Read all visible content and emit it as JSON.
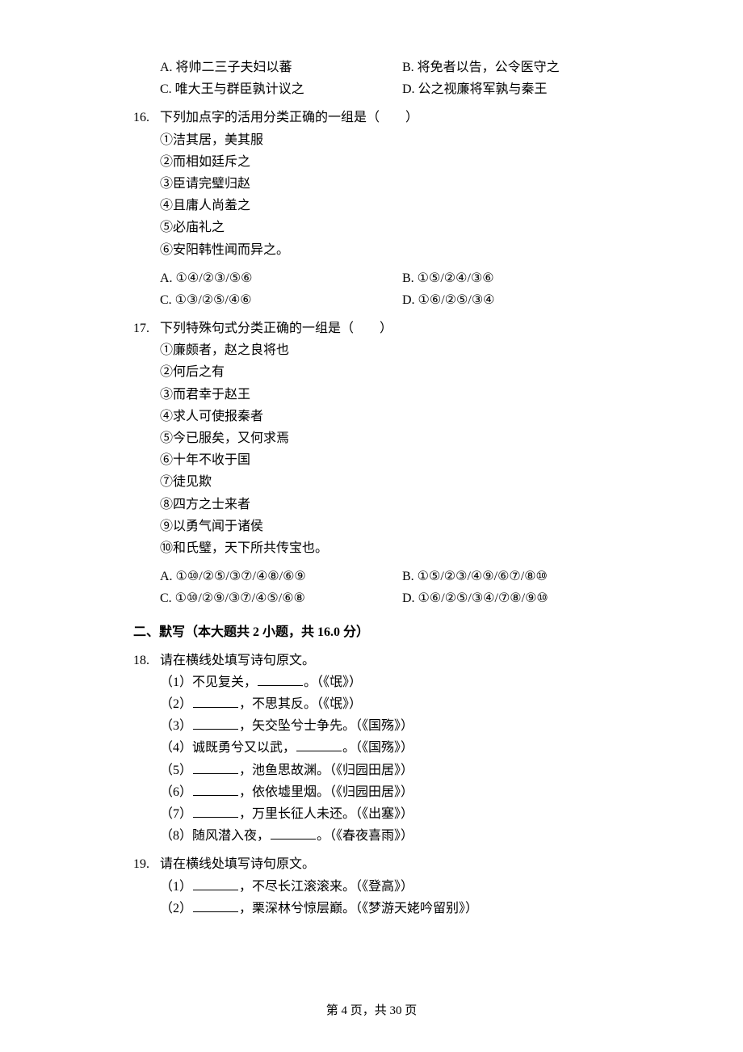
{
  "q15_opts": {
    "A": "A. 将帅二三子夫妇以蕃",
    "B": "B. 将免者以告，公令医守之",
    "C": "C. 唯大王与群臣孰计议之",
    "D": "D. 公之视廉将军孰与秦王"
  },
  "q16": {
    "num": "16.",
    "stem": "下列加点字的活用分类正确的一组是（　　）",
    "items": [
      "①洁其居，美其服",
      "②而相如廷斥之",
      "③臣请完璧归赵",
      "④且庸人尚羞之",
      "⑤必庙礼之",
      "⑥安阳韩性闻而异之。"
    ],
    "opts": {
      "A": "A. ①④/②③/⑤⑥",
      "B": "B. ①⑤/②④/③⑥",
      "C": "C. ①③/②⑤/④⑥",
      "D": "D. ①⑥/②⑤/③④"
    }
  },
  "q17": {
    "num": "17.",
    "stem": "下列特殊句式分类正确的一组是（　　）",
    "items": [
      "①廉颇者，赵之良将也",
      "②何后之有",
      "③而君幸于赵王",
      "④求人可使报秦者",
      "⑤今已服矣，又何求焉",
      "⑥十年不收于国",
      "⑦徒见欺",
      "⑧四方之士来者",
      "⑨以勇气闻于诸侯",
      "⑩和氏璧，天下所共传宝也。"
    ],
    "opts": {
      "A": "A. ①⑩/②⑤/③⑦/④⑧/⑥⑨",
      "B": "B. ①⑤/②③/④⑨/⑥⑦/⑧⑩",
      "C": "C. ①⑩/②⑨/③⑦/④⑤/⑥⑧",
      "D": "D. ①⑥/②⑤/③④/⑦⑧/⑨⑩"
    }
  },
  "section2": "二、默写（本大题共 2 小题，共 16.0 分）",
  "q18": {
    "num": "18.",
    "stem": "请在横线处填写诗句原文。",
    "lines": [
      {
        "pre": "（1）不见复关，",
        "post": "。（《氓》）"
      },
      {
        "pre": "（2）",
        "post": "，不思其反。（《氓》）"
      },
      {
        "pre": "（3）",
        "post": "，矢交坠兮士争先。（《国殇》）"
      },
      {
        "pre": "（4）诚既勇兮又以武，",
        "post": "。（《国殇》）"
      },
      {
        "pre": "（5）",
        "post": "，池鱼思故渊。（《归园田居》）"
      },
      {
        "pre": "（6）",
        "post": "，依依墟里烟。（《归园田居》）"
      },
      {
        "pre": "（7）",
        "post": "，万里长征人未还。（《出塞》）"
      },
      {
        "pre": "（8）随风潜入夜，",
        "post": "。（《春夜喜雨》）"
      }
    ]
  },
  "q19": {
    "num": "19.",
    "stem": "请在横线处填写诗句原文。",
    "lines": [
      {
        "pre": "（1）",
        "post": "，不尽长江滚滚来。（《登高》）"
      },
      {
        "pre": "（2）",
        "post": "，栗深林兮惊层巅。（《梦游天姥吟留别》）"
      }
    ]
  },
  "footer": {
    "pre": "第 ",
    "cur": "4",
    "mid": " 页，共 ",
    "tot": "30",
    "post": " 页"
  }
}
